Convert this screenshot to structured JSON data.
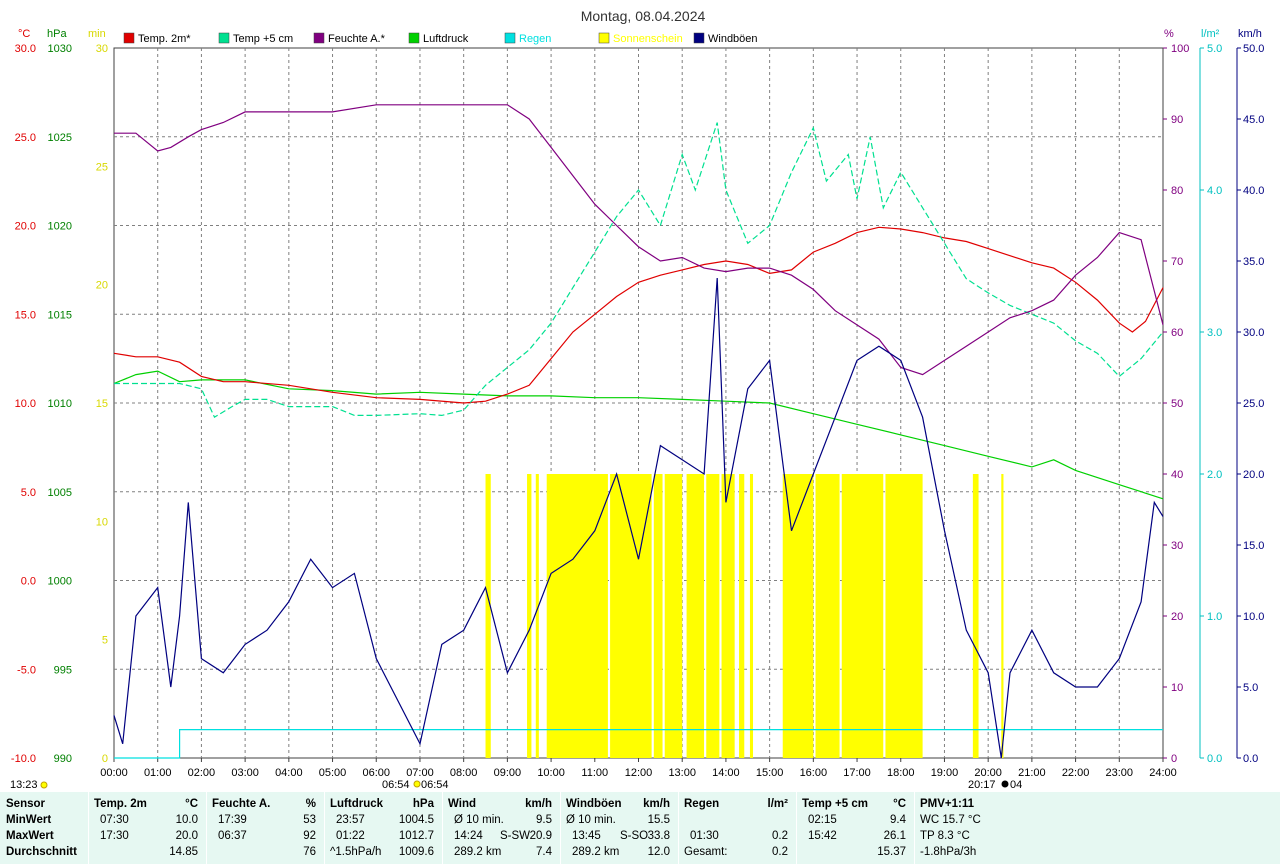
{
  "title": "Montag, 08.04.2024",
  "axis_units": {
    "temp": "°C",
    "pressure": "hPa",
    "sun": "min",
    "humidity": "%",
    "rain": "l/m²",
    "wind": "km/h"
  },
  "left_temp_ticks": [
    "30.0",
    "25.0",
    "20.0",
    "15.0",
    "10.0",
    "5.0",
    "0.0",
    "-5.0",
    "-10.0"
  ],
  "left_pressure_ticks": [
    "1030",
    "1025",
    "1020",
    "1015",
    "1010",
    "1005",
    "1000",
    "995",
    "990"
  ],
  "left_sun_ticks": [
    "30",
    "25",
    "20",
    "15",
    "10",
    "5",
    "0"
  ],
  "right_humidity_ticks": [
    "100",
    "90",
    "80",
    "70",
    "60",
    "50",
    "40",
    "30",
    "20",
    "10",
    "0"
  ],
  "right_rain_ticks": [
    "5.0",
    "4.0",
    "3.0",
    "2.0",
    "1.0",
    "0.0"
  ],
  "right_wind_ticks": [
    "50.0",
    "45.0",
    "40.0",
    "35.0",
    "30.0",
    "25.0",
    "20.0",
    "15.0",
    "10.0",
    "5.0",
    "0.0"
  ],
  "x_ticks": [
    "00:00",
    "01:00",
    "02:00",
    "03:00",
    "04:00",
    "05:00",
    "06:00",
    "07:00",
    "08:00",
    "09:00",
    "10:00",
    "11:00",
    "12:00",
    "13:00",
    "14:00",
    "15:00",
    "16:00",
    "17:00",
    "18:00",
    "19:00",
    "20:00",
    "21:00",
    "22:00",
    "23:00",
    "24:00"
  ],
  "time_now": "13:23",
  "sunrise_label": "06:54",
  "sunrise_label2": "06:54",
  "sunset_label": "20:17",
  "sunset_label2": "04",
  "legend": [
    {
      "label": "Temp. 2m*",
      "color": "#e00000"
    },
    {
      "label": "Temp +5 cm",
      "color": "#00e090"
    },
    {
      "label": "Feuchte A.*",
      "color": "#800080"
    },
    {
      "label": "Luftdruck",
      "color": "#00d000"
    },
    {
      "label": "Regen",
      "color": "#00e0e0"
    },
    {
      "label": "Sonnenschein",
      "color": "#ffff00"
    },
    {
      "label": "Windböen",
      "color": "#000080"
    }
  ],
  "chart_data": {
    "type": "line",
    "x_unit": "hour",
    "x_range": [
      0,
      24
    ],
    "grid": true,
    "series": [
      {
        "name": "Temp. 2m*",
        "axis": "temp",
        "points": [
          [
            0,
            12.8
          ],
          [
            0.5,
            12.6
          ],
          [
            1,
            12.6
          ],
          [
            1.5,
            12.3
          ],
          [
            2,
            11.5
          ],
          [
            2.5,
            11.2
          ],
          [
            3,
            11.2
          ],
          [
            4,
            11
          ],
          [
            5,
            10.6
          ],
          [
            6,
            10.3
          ],
          [
            7,
            10.2
          ],
          [
            8,
            10
          ],
          [
            8.5,
            10.1
          ],
          [
            9,
            10.5
          ],
          [
            9.5,
            11
          ],
          [
            10,
            12.5
          ],
          [
            10.5,
            14
          ],
          [
            11,
            15
          ],
          [
            11.5,
            16
          ],
          [
            12,
            16.8
          ],
          [
            12.5,
            17.2
          ],
          [
            13,
            17.5
          ],
          [
            13.5,
            17.8
          ],
          [
            14,
            18
          ],
          [
            14.5,
            17.8
          ],
          [
            15,
            17.3
          ],
          [
            15.5,
            17.5
          ],
          [
            16,
            18.5
          ],
          [
            16.5,
            19
          ],
          [
            17,
            19.6
          ],
          [
            17.5,
            19.9
          ],
          [
            18,
            19.8
          ],
          [
            18.5,
            19.6
          ],
          [
            19,
            19.3
          ],
          [
            19.5,
            19.1
          ],
          [
            20,
            18.7
          ],
          [
            20.5,
            18.3
          ],
          [
            21,
            17.9
          ],
          [
            21.5,
            17.6
          ],
          [
            22,
            16.8
          ],
          [
            22.5,
            15.8
          ],
          [
            23,
            14.5
          ],
          [
            23.3,
            14.0
          ],
          [
            23.6,
            14.6
          ],
          [
            24,
            16.5
          ]
        ]
      },
      {
        "name": "Temp +5 cm",
        "axis": "temp",
        "points": [
          [
            0,
            11.1
          ],
          [
            1,
            11.1
          ],
          [
            1.5,
            11.1
          ],
          [
            2,
            10.8
          ],
          [
            2.3,
            9.2
          ],
          [
            2.7,
            9.8
          ],
          [
            3,
            10.2
          ],
          [
            3.5,
            10.2
          ],
          [
            4,
            9.8
          ],
          [
            5,
            9.8
          ],
          [
            5.5,
            9.3
          ],
          [
            6,
            9.3
          ],
          [
            7,
            9.4
          ],
          [
            7.5,
            9.3
          ],
          [
            8,
            9.6
          ],
          [
            8.5,
            11
          ],
          [
            9,
            12
          ],
          [
            9.5,
            13
          ],
          [
            10,
            14.5
          ],
          [
            10.5,
            16.5
          ],
          [
            11,
            18.5
          ],
          [
            11.5,
            20.5
          ],
          [
            12,
            22
          ],
          [
            12.5,
            20
          ],
          [
            13,
            24
          ],
          [
            13.3,
            22
          ],
          [
            13.8,
            25.8
          ],
          [
            14,
            22
          ],
          [
            14.5,
            19
          ],
          [
            15,
            20
          ],
          [
            15.5,
            23
          ],
          [
            16,
            25.5
          ],
          [
            16.3,
            22.5
          ],
          [
            16.8,
            24
          ],
          [
            17,
            21.5
          ],
          [
            17.3,
            25
          ],
          [
            17.6,
            21
          ],
          [
            18,
            23
          ],
          [
            18.5,
            21
          ],
          [
            19,
            19
          ],
          [
            19.5,
            17
          ],
          [
            20,
            16.2
          ],
          [
            20.5,
            15.5
          ],
          [
            21,
            15
          ],
          [
            21.5,
            14.5
          ],
          [
            22,
            13.5
          ],
          [
            22.5,
            12.8
          ],
          [
            23,
            11.5
          ],
          [
            23.5,
            12.5
          ],
          [
            24,
            14
          ]
        ]
      },
      {
        "name": "Feuchte A.*",
        "axis": "humidity",
        "points": [
          [
            0,
            88
          ],
          [
            0.5,
            88
          ],
          [
            1,
            85.5
          ],
          [
            1.3,
            86
          ],
          [
            1.7,
            87.5
          ],
          [
            2,
            88.5
          ],
          [
            2.5,
            89.5
          ],
          [
            3,
            91
          ],
          [
            4,
            91
          ],
          [
            5,
            91
          ],
          [
            6,
            92
          ],
          [
            7,
            92
          ],
          [
            8,
            92
          ],
          [
            9,
            92
          ],
          [
            9.5,
            90
          ],
          [
            10,
            86
          ],
          [
            10.5,
            82
          ],
          [
            11,
            78
          ],
          [
            11.5,
            75
          ],
          [
            12,
            72
          ],
          [
            12.5,
            70
          ],
          [
            13,
            70.5
          ],
          [
            13.5,
            69
          ],
          [
            14,
            68.5
          ],
          [
            14.5,
            69
          ],
          [
            15,
            69
          ],
          [
            15.5,
            68
          ],
          [
            16,
            66
          ],
          [
            16.5,
            63
          ],
          [
            17,
            61
          ],
          [
            17.5,
            59
          ],
          [
            18,
            55
          ],
          [
            18.5,
            54
          ],
          [
            19,
            56
          ],
          [
            19.5,
            58
          ],
          [
            20,
            60
          ],
          [
            20.5,
            62
          ],
          [
            21,
            63
          ],
          [
            21.5,
            64.5
          ],
          [
            22,
            68
          ],
          [
            22.5,
            70.5
          ],
          [
            23,
            74
          ],
          [
            23.5,
            73
          ],
          [
            24,
            61
          ]
        ]
      },
      {
        "name": "Luftdruck",
        "axis": "pressure",
        "points": [
          [
            0,
            1011.1
          ],
          [
            0.5,
            1011.6
          ],
          [
            1,
            1011.8
          ],
          [
            1.5,
            1011.2
          ],
          [
            2,
            1011.3
          ],
          [
            3,
            1011.3
          ],
          [
            4,
            1010.8
          ],
          [
            5,
            1010.7
          ],
          [
            6,
            1010.5
          ],
          [
            7,
            1010.6
          ],
          [
            8,
            1010.5
          ],
          [
            9,
            1010.4
          ],
          [
            10,
            1010.4
          ],
          [
            11,
            1010.3
          ],
          [
            12,
            1010.3
          ],
          [
            13,
            1010.2
          ],
          [
            14,
            1010.1
          ],
          [
            15,
            1010
          ],
          [
            16,
            1009.4
          ],
          [
            17,
            1008.8
          ],
          [
            18,
            1008.2
          ],
          [
            19,
            1007.6
          ],
          [
            20,
            1007.0
          ],
          [
            21,
            1006.4
          ],
          [
            21.5,
            1006.8
          ],
          [
            22,
            1006.2
          ],
          [
            23,
            1005.4
          ],
          [
            24,
            1004.6
          ]
        ]
      },
      {
        "name": "Regen",
        "axis": "rain",
        "points": [
          [
            0,
            0
          ],
          [
            1.5,
            0
          ],
          [
            1.5,
            0.2
          ],
          [
            24,
            0.2
          ]
        ]
      },
      {
        "name": "Windböen",
        "axis": "wind",
        "points": [
          [
            0,
            3
          ],
          [
            0.2,
            1
          ],
          [
            0.5,
            10
          ],
          [
            1,
            12
          ],
          [
            1.3,
            5
          ],
          [
            1.5,
            10
          ],
          [
            1.7,
            18
          ],
          [
            2,
            7
          ],
          [
            2.5,
            6
          ],
          [
            3,
            8
          ],
          [
            3.5,
            9
          ],
          [
            4,
            11
          ],
          [
            4.5,
            14
          ],
          [
            5,
            12
          ],
          [
            5.5,
            13
          ],
          [
            6,
            7
          ],
          [
            7,
            1
          ],
          [
            7.5,
            8
          ],
          [
            8,
            9
          ],
          [
            8.5,
            12
          ],
          [
            9,
            6
          ],
          [
            9.5,
            9
          ],
          [
            10,
            13
          ],
          [
            10.5,
            14
          ],
          [
            11,
            16
          ],
          [
            11.5,
            20
          ],
          [
            12,
            14
          ],
          [
            12.5,
            22
          ],
          [
            13,
            21
          ],
          [
            13.5,
            20
          ],
          [
            13.8,
            33.8
          ],
          [
            14,
            18
          ],
          [
            14.5,
            26
          ],
          [
            15,
            28
          ],
          [
            15.5,
            16
          ],
          [
            16,
            20
          ],
          [
            16.5,
            24
          ],
          [
            17,
            28
          ],
          [
            17.5,
            29
          ],
          [
            18,
            28
          ],
          [
            18.5,
            24
          ],
          [
            19,
            16
          ],
          [
            19.5,
            9
          ],
          [
            20,
            6
          ],
          [
            20.3,
            0
          ],
          [
            20.5,
            6
          ],
          [
            21,
            9
          ],
          [
            21.5,
            6
          ],
          [
            22,
            5
          ],
          [
            22.5,
            5
          ],
          [
            23,
            7
          ],
          [
            23.5,
            11
          ],
          [
            23.8,
            18
          ],
          [
            24,
            17
          ]
        ]
      }
    ],
    "sunshine_bars": [
      [
        8.5,
        8.62
      ],
      [
        9.45,
        9.55
      ],
      [
        9.65,
        9.72
      ],
      [
        9.9,
        11.3
      ],
      [
        11.35,
        12.3
      ],
      [
        12.35,
        12.55
      ],
      [
        12.6,
        13.0
      ],
      [
        13.1,
        13.5
      ],
      [
        13.55,
        13.85
      ],
      [
        13.9,
        14.2
      ],
      [
        14.3,
        14.42
      ],
      [
        14.55,
        14.62
      ],
      [
        15.3,
        16.0
      ],
      [
        16.05,
        16.6
      ],
      [
        16.65,
        17.6
      ],
      [
        17.65,
        18.5
      ],
      [
        19.65,
        19.78
      ],
      [
        20.3,
        20.35
      ]
    ]
  },
  "stats": {
    "sensor": {
      "title": "Sensor",
      "rows": [
        "MinWert",
        "MaxWert",
        "Durchschnitt"
      ]
    },
    "temp2m": {
      "title": "Temp. 2m",
      "unit": "°C",
      "r1a": "07:30",
      "r1b": "10.0",
      "r2a": "17:30",
      "r2b": "20.0",
      "r3a": "",
      "r3b": "14.85"
    },
    "feuchte": {
      "title": "Feuchte A.",
      "unit": "%",
      "r1a": "17:39",
      "r1b": "53",
      "r2a": "06:37",
      "r2b": "92",
      "r3a": "",
      "r3b": "76"
    },
    "luftdruck": {
      "title": "Luftdruck",
      "unit": "hPa",
      "r1a": "23:57",
      "r1b": "1004.5",
      "r2a": "01:22",
      "r2b": "1012.7",
      "r3a": "^1.5hPa/h",
      "r3b": "1009.6"
    },
    "wind": {
      "title": "Wind",
      "unit": "km/h",
      "r1a": "Ø 10 min.",
      "r1b": "9.5",
      "r2a": "14:24",
      "r2m": "S-SW",
      "r2b": "20.9",
      "r3a": "289.2 km",
      "r3b": "7.4"
    },
    "windboeen": {
      "title": "Windböen",
      "unit": "km/h",
      "r1a": "Ø 10 min.",
      "r1b": "15.5",
      "r2a": "13:45",
      "r2m": "S-SO",
      "r2b": "33.8",
      "r3a": "289.2 km",
      "r3b": "12.0"
    },
    "regen": {
      "title": "Regen",
      "unit": "l/m²",
      "r1a": "",
      "r1b": "",
      "r2a": "01:30",
      "r2b": "0.2",
      "r3a": "Gesamt:",
      "r3b": "0.2"
    },
    "temp5cm": {
      "title": "Temp +5 cm",
      "unit": "°C",
      "r1a": "02:15",
      "r1b": "9.4",
      "r2a": "15:42",
      "r2b": "26.1",
      "r3a": "",
      "r3b": "15.37"
    },
    "pmv": {
      "title": "PMV+1:11",
      "r1": "WC 15.7 °C",
      "r2": "TP 8.3 °C",
      "r3": "-1.8hPa/3h"
    }
  }
}
